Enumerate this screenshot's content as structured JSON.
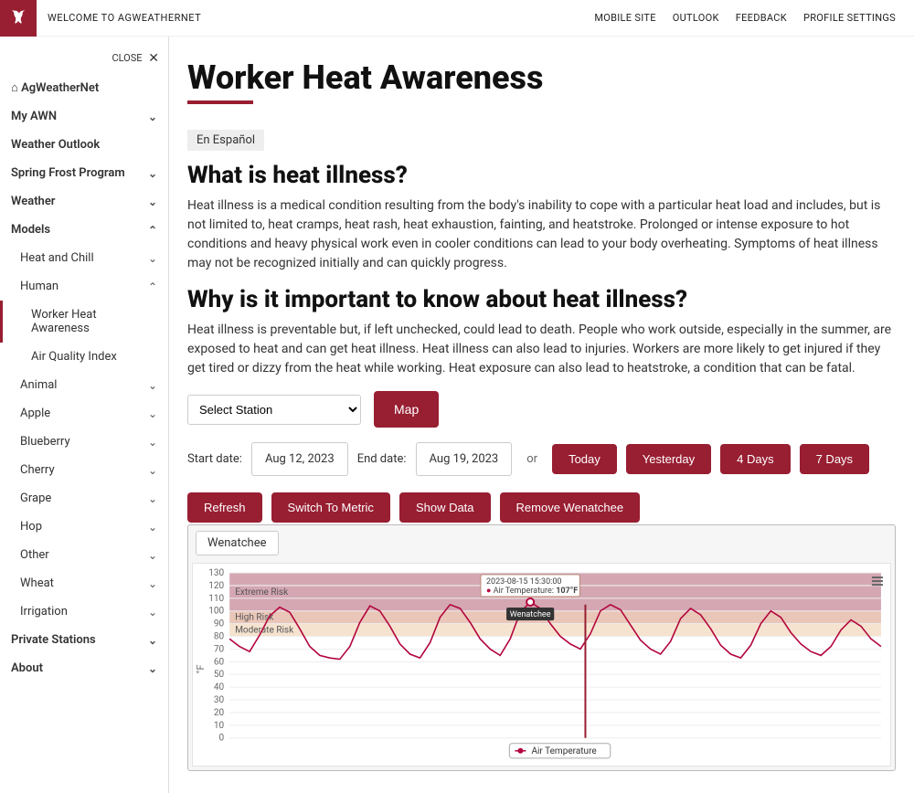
{
  "topbar": {
    "welcome": "WELCOME TO AGWEATHERNET",
    "links": [
      "MOBILE SITE",
      "OUTLOOK",
      "FEEDBACK",
      "PROFILE SETTINGS"
    ]
  },
  "sidebar": {
    "close": "CLOSE",
    "items": [
      {
        "label": "AgWeatherNet",
        "icon": "home"
      },
      {
        "label": "My AWN",
        "chev": "down"
      },
      {
        "label": "Weather Outlook"
      },
      {
        "label": "Spring Frost Program",
        "chev": "down"
      },
      {
        "label": "Weather",
        "chev": "down"
      },
      {
        "label": "Models",
        "chev": "up"
      },
      {
        "label": "Private Stations",
        "chev": "down"
      },
      {
        "label": "About",
        "chev": "down"
      }
    ],
    "models_children": [
      {
        "label": "Heat and Chill",
        "chev": "down"
      },
      {
        "label": "Human",
        "chev": "up"
      },
      {
        "label": "Animal",
        "chev": "down"
      },
      {
        "label": "Apple",
        "chev": "down"
      },
      {
        "label": "Blueberry",
        "chev": "down"
      },
      {
        "label": "Cherry",
        "chev": "down"
      },
      {
        "label": "Grape",
        "chev": "down"
      },
      {
        "label": "Hop",
        "chev": "down"
      },
      {
        "label": "Other",
        "chev": "down"
      },
      {
        "label": "Wheat",
        "chev": "down"
      },
      {
        "label": "Irrigation",
        "chev": "down"
      }
    ],
    "human_children": [
      {
        "label": "Worker Heat Awareness",
        "active": true
      },
      {
        "label": "Air Quality Index"
      }
    ]
  },
  "page": {
    "title": "Worker Heat Awareness",
    "espanol": "En Español",
    "h2a": "What is heat illness?",
    "p1": "Heat illness is a medical condition resulting from the body's inability to cope with a particular heat load and includes, but is not limited to, heat cramps, heat rash, heat exhaustion, fainting, and heatstroke. Prolonged or intense exposure to hot conditions and heavy physical work even in cooler conditions can lead to your body overheating. Symptoms of heat illness may not be recognized initially and can quickly progress.",
    "h2b": "Why is it important to know about heat illness?",
    "p2": "Heat illness is preventable but, if left unchecked, could lead to death. People who work outside, especially in the summer, are exposed to heat and can get heat illness. Heat illness can also lead to injuries. Workers are more likely to get injured if they get tired or dizzy from the heat while working. Heat exposure can also lead to heatstroke, a condition that can be fatal."
  },
  "controls": {
    "station_placeholder": "Select Station",
    "map": "Map",
    "start_label": "Start date:",
    "start_value": "Aug 12, 2023",
    "end_label": "End date:",
    "end_value": "Aug 19, 2023",
    "or": "or",
    "today": "Today",
    "yesterday": "Yesterday",
    "four_days": "4 Days",
    "seven_days": "7 Days",
    "refresh": "Refresh",
    "metric": "Switch To Metric",
    "show_data": "Show Data",
    "remove": "Remove Wenatchee"
  },
  "chart_tab": "Wenatchee",
  "chart_data": {
    "type": "line",
    "series_name": "Air Temperature",
    "station": "Wenatchee",
    "ylabel": "°F",
    "ylim": [
      0,
      130
    ],
    "yticks": [
      0,
      10,
      20,
      30,
      40,
      50,
      60,
      70,
      80,
      90,
      100,
      110,
      120,
      130
    ],
    "bands": [
      {
        "label": "Extreme Risk",
        "from": 100,
        "to": 130,
        "color": "#c68a9a"
      },
      {
        "label": "High Risk",
        "from": 90,
        "to": 100,
        "color": "#e2b3a0"
      },
      {
        "label": "Moderate Risk",
        "from": 80,
        "to": 90,
        "color": "#f1d9bf"
      }
    ],
    "tooltip": {
      "time": "2023-08-15 15:30:00",
      "label": "Air Temperature:",
      "value": "107°F"
    },
    "points": [
      [
        0,
        78
      ],
      [
        1,
        72
      ],
      [
        2,
        68
      ],
      [
        3,
        81
      ],
      [
        4,
        96
      ],
      [
        5,
        103
      ],
      [
        6,
        99
      ],
      [
        7,
        86
      ],
      [
        8,
        72
      ],
      [
        9,
        65
      ],
      [
        10,
        63
      ],
      [
        11,
        62
      ],
      [
        12,
        72
      ],
      [
        13,
        91
      ],
      [
        14,
        104
      ],
      [
        15,
        100
      ],
      [
        16,
        88
      ],
      [
        17,
        74
      ],
      [
        18,
        66
      ],
      [
        19,
        63
      ],
      [
        20,
        75
      ],
      [
        21,
        95
      ],
      [
        22,
        105
      ],
      [
        23,
        102
      ],
      [
        24,
        91
      ],
      [
        25,
        78
      ],
      [
        26,
        70
      ],
      [
        27,
        65
      ],
      [
        28,
        78
      ],
      [
        29,
        99
      ],
      [
        30,
        107
      ],
      [
        31,
        102
      ],
      [
        32,
        90
      ],
      [
        33,
        80
      ],
      [
        34,
        74
      ],
      [
        35,
        70
      ],
      [
        36,
        82
      ],
      [
        37,
        100
      ],
      [
        38,
        105
      ],
      [
        39,
        101
      ],
      [
        40,
        89
      ],
      [
        41,
        77
      ],
      [
        42,
        70
      ],
      [
        43,
        66
      ],
      [
        44,
        76
      ],
      [
        45,
        94
      ],
      [
        46,
        102
      ],
      [
        47,
        97
      ],
      [
        48,
        86
      ],
      [
        49,
        73
      ],
      [
        50,
        66
      ],
      [
        51,
        63
      ],
      [
        52,
        73
      ],
      [
        53,
        90
      ],
      [
        54,
        100
      ],
      [
        55,
        95
      ],
      [
        56,
        83
      ],
      [
        57,
        74
      ],
      [
        58,
        68
      ],
      [
        59,
        65
      ],
      [
        60,
        72
      ],
      [
        61,
        85
      ],
      [
        62,
        93
      ],
      [
        63,
        88
      ],
      [
        64,
        78
      ],
      [
        65,
        72
      ]
    ],
    "spike_x": 35.5,
    "tooltip_x": 30,
    "legend": "Air Temperature"
  }
}
